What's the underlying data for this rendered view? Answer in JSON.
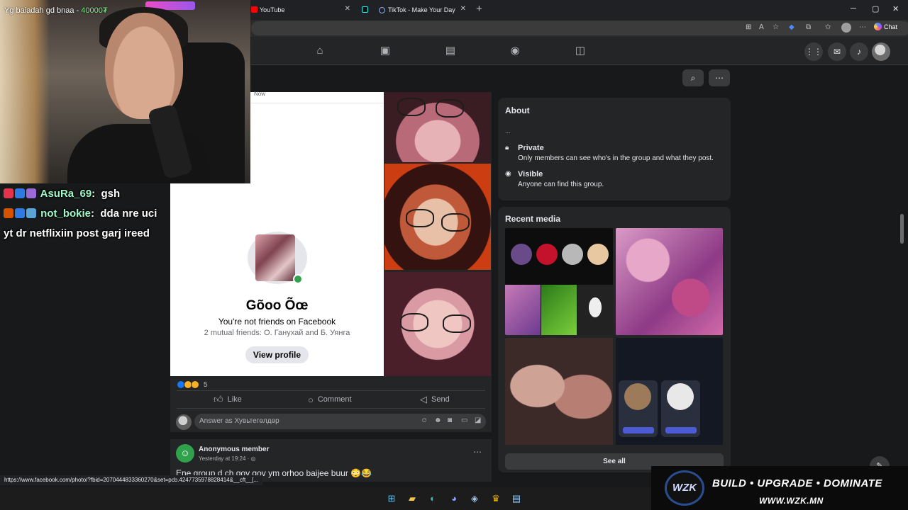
{
  "browser": {
    "tabs": [
      {
        "label": "YouTube",
        "fav_color": "#ff0000"
      },
      {
        "label": "TikTok - Make Your Day",
        "fav_color": "#25f4ee"
      }
    ],
    "new_tab": "+",
    "window_controls": [
      "─",
      "▢",
      "✕"
    ],
    "chat_label": "Chat"
  },
  "facebook": {
    "post": {
      "timestamp": "Now",
      "profile_card": {
        "name": "Gõoo Õœ",
        "friend_status": "You're not friends on Facebook",
        "mutual": "2 mutual friends: О. Ганухай and Б. Уянга",
        "view_profile": "View profile"
      },
      "reaction_count": "5",
      "actions": {
        "like": "Like",
        "comment": "Comment",
        "send": "Send"
      },
      "answer_placeholder": "Answer as Хувьтегөлдөр"
    },
    "post2": {
      "author": "Anonymous member",
      "time": "Yesterday at 19:24 · ",
      "text": "Ene group d ch gov gov ym orhoo baijee buur 😳😂"
    },
    "about": {
      "title": "About",
      "desc": "...",
      "private_title": "Private",
      "private_desc": "Only members can see who's in the group and what they post.",
      "visible_title": "Visible",
      "visible_desc": "Anyone can find this group."
    },
    "recent_media": {
      "title": "Recent media",
      "see_all": "See all"
    }
  },
  "stream": {
    "banner_name": "Yg baiadah gd bnaa - ",
    "banner_amount": "40000₮",
    "chat": [
      {
        "user": "AsuRa_69",
        "msg": "gsh"
      },
      {
        "user": "not_bokie",
        "msg": "dda nre uci"
      },
      {
        "user": "",
        "msg": "yt dr netflixiin post garj ireed"
      }
    ]
  },
  "status_url": "https://www.facebook.com/photo/?fbid=2070444833360270&set=pcb.4247735978828414&__cft__[...",
  "sponsor": {
    "logo": "WZK",
    "tagline": "BUILD • UPGRADE • DOMINATE",
    "url": "WWW.WZK.MN"
  }
}
